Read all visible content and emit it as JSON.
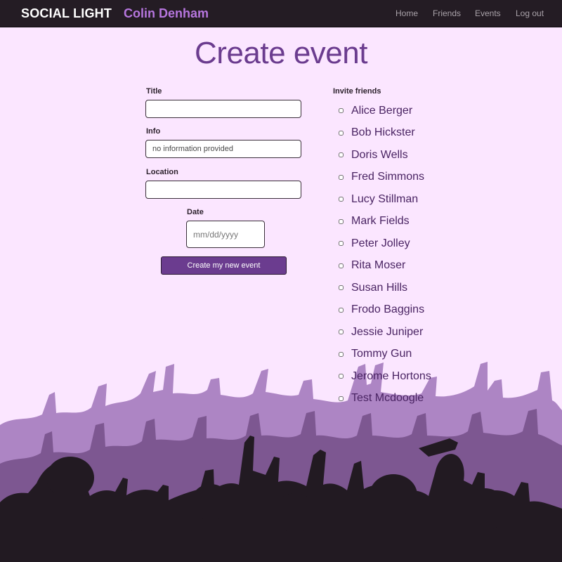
{
  "navbar": {
    "brand": "SOCIAL LIGHT",
    "user_name": "Colin Denham",
    "links": [
      "Home",
      "Friends",
      "Events",
      "Log out"
    ]
  },
  "page": {
    "title": "Create event"
  },
  "form": {
    "title_label": "Title",
    "title_value": "",
    "info_label": "Info",
    "info_placeholder": "no information provided",
    "location_label": "Location",
    "location_value": "",
    "date_label": "Date",
    "date_placeholder": "mm/dd/yyyy",
    "submit_label": "Create my new event"
  },
  "invite": {
    "label": "Invite friends",
    "friends": [
      "Alice Berger",
      "Bob Hickster",
      "Doris Wells",
      "Fred Simmons",
      "Lucy Stillman",
      "Mark Fields",
      "Peter Jolley",
      "Rita Moser",
      "Susan Hills",
      "Frodo Baggins",
      "Jessie Juniper",
      "Tommy Gun",
      "Jerome Hortons",
      "Test Mcdoogle"
    ]
  },
  "colors": {
    "background": "#fbe6ff",
    "navbar": "#241c24",
    "accent": "#6b3c8f",
    "user_name": "#b676de",
    "crowd_back": "#ad85c4",
    "crowd_mid": "#7d5791",
    "crowd_front": "#221a22"
  },
  "icons": [
    "concert-crowd-silhouette"
  ]
}
